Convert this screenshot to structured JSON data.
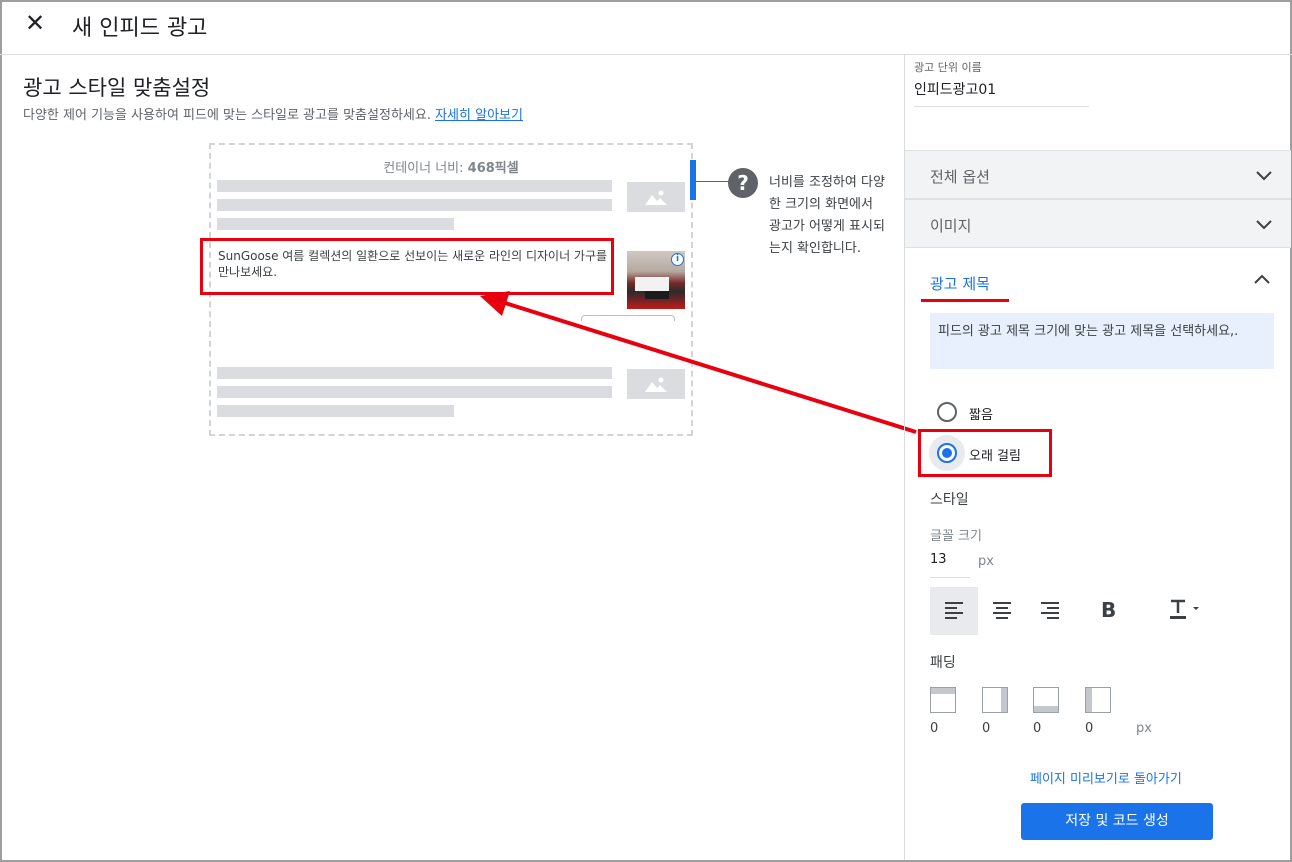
{
  "header": {
    "close_glyph": "✕",
    "title": "새 인피드 광고"
  },
  "main": {
    "title": "광고 스타일 맞춤설정",
    "subtitle": "다양한 제어 기능을 사용하여 피드에 맞는 스타일로 광고를 맞춤설정하세요.",
    "learn_more": "자세히 알아보기",
    "preview": {
      "width_label": "컨테이너 너비:",
      "width_value": "468픽셀",
      "ad_text": "SunGoose 여름 컬렉션의 일환으로 선보이는 새로운 라인의 디자이너 가구를 만나보세요.",
      "info_glyph": "i"
    },
    "help": {
      "glyph": "?",
      "text": "너비를 조정하여 다양한 크기의 화면에서 광고가 어떻게 표시되는지 확인합니다."
    }
  },
  "panel": {
    "unit_name_label": "광고 단위 이름",
    "unit_name_value": "인피드광고01",
    "sections": {
      "global": "전체 옵션",
      "image": "이미지",
      "headline": "광고 제목"
    },
    "headline": {
      "info": "피드의 광고 제목 크기에 맞는 광고 제목을 선택하세요,.",
      "options": [
        {
          "label": "짧음",
          "selected": false
        },
        {
          "label": "오래 걸림",
          "selected": true
        }
      ],
      "style_label": "스타일",
      "font_size_label": "글꼴 크기",
      "font_size_value": "13",
      "font_unit": "px",
      "bold_glyph": "B",
      "padding_label": "패딩",
      "padding_values": [
        "0",
        "0",
        "0",
        "0"
      ],
      "padding_unit": "px"
    },
    "back_link": "페이지 미리보기로 돌아가기",
    "save_button": "저장 및 코드 생성"
  },
  "colors": {
    "accent": "#1a73e8",
    "highlight_red": "#e8000f",
    "placeholder_gray": "#dadce0"
  }
}
